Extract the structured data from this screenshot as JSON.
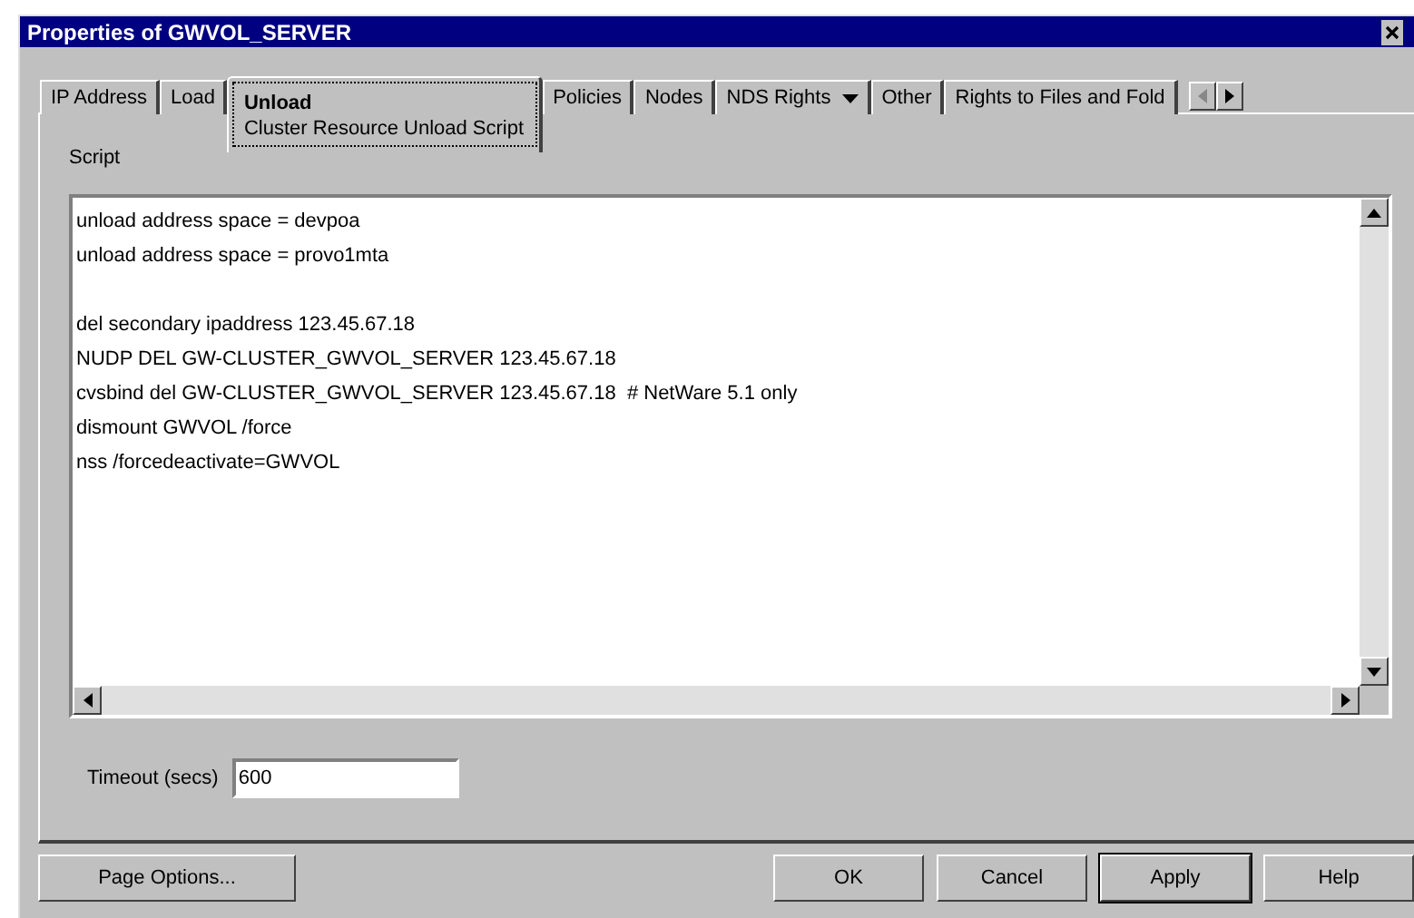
{
  "window": {
    "title": "Properties of GWVOL_SERVER"
  },
  "tabs": [
    {
      "label": "IP Address",
      "selected": false
    },
    {
      "label": "Load",
      "selected": false
    },
    {
      "label": "Unload",
      "subtitle": "Cluster Resource Unload Script",
      "selected": true
    },
    {
      "label": "Policies",
      "selected": false
    },
    {
      "label": "Nodes",
      "selected": false
    },
    {
      "label": "NDS Rights",
      "dropdown": true,
      "selected": false
    },
    {
      "label": "Other",
      "selected": false
    },
    {
      "label": "Rights to Files and Fold",
      "selected": false
    }
  ],
  "script": {
    "label": "Script",
    "paragraphs": [
      [
        "unload address space = devpoa",
        "unload address space = provo1mta"
      ],
      [
        "del secondary ipaddress 123.45.67.18",
        "NUDP DEL GW-CLUSTER_GWVOL_SERVER 123.45.67.18",
        "cvsbind del GW-CLUSTER_GWVOL_SERVER 123.45.67.18  # NetWare 5.1 only",
        "dismount GWVOL /force",
        "nss /forcedeactivate=GWVOL"
      ]
    ]
  },
  "timeout": {
    "label": "Timeout (secs)",
    "value": "600"
  },
  "buttons": [
    {
      "label": "Page Options...",
      "default": false
    },
    {
      "label": "OK",
      "default": false
    },
    {
      "label": "Cancel",
      "default": false
    },
    {
      "label": "Apply",
      "default": true
    },
    {
      "label": "Help",
      "default": false
    }
  ]
}
